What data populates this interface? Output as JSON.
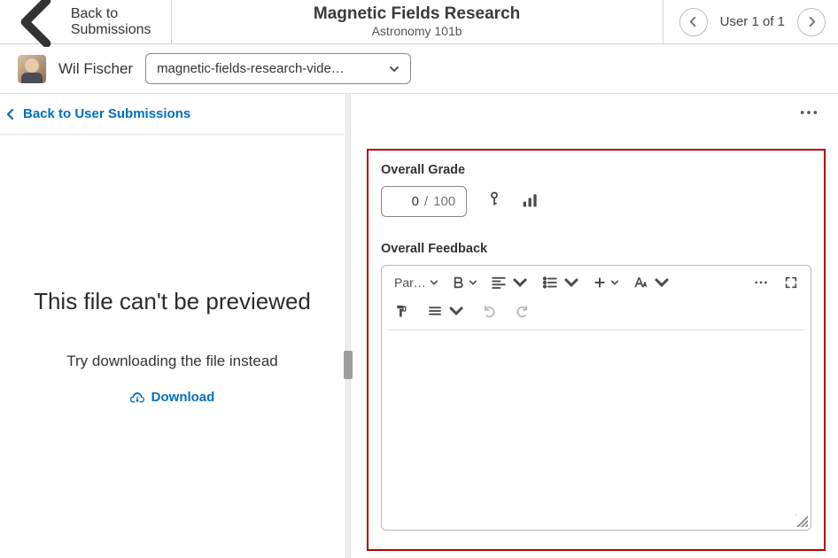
{
  "topbar": {
    "back_label": "Back to Submissions",
    "title": "Magnetic Fields Research",
    "subtitle": "Astronomy 101b",
    "user_position": "User 1 of 1"
  },
  "student": {
    "name": "Wil Fischer",
    "file_dropdown": "magnetic-fields-research-vide…"
  },
  "left": {
    "back_link": "Back to User Submissions",
    "preview_headline": "This file can't be previewed",
    "preview_sub": "Try downloading the file instead",
    "download_label": "Download"
  },
  "grading": {
    "overall_grade_label": "Overall Grade",
    "grade_value": "0",
    "grade_max": "100",
    "overall_feedback_label": "Overall Feedback"
  },
  "rte": {
    "paragraph_label": "Par…"
  }
}
